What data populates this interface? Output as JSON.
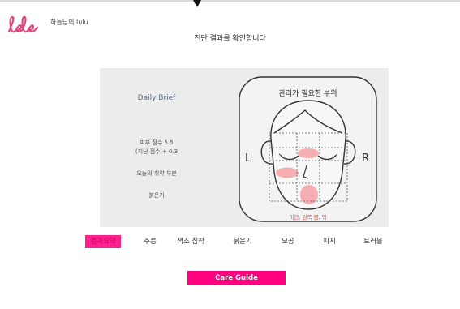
{
  "header": {
    "user_name": "하늘님의 lulu",
    "headline": "진단 결과를 확인합니다"
  },
  "brief": {
    "title": "Daily Brief",
    "skin_score": "피부 점수 5.5",
    "score_change": "(지난 점수 + 0.3",
    "weak_area_label": "오늘의 취약 부분",
    "weak_area_value": "붉은기"
  },
  "face": {
    "title": "관리가 필요한 부위",
    "left_label": "L",
    "right_label": "R",
    "footnote": "미간, 왼쪽 뺨, 턱",
    "highlight_color": "#f4a5a8"
  },
  "tabs": [
    {
      "label": "결과요약",
      "active": true
    },
    {
      "label": "주름"
    },
    {
      "label": "색소 침착"
    },
    {
      "label": "붉은기"
    },
    {
      "label": "모공"
    },
    {
      "label": "피지"
    },
    {
      "label": "트러블"
    }
  ],
  "care_guide": {
    "label": "Care Guide"
  },
  "colors": {
    "accent": "#ff0080",
    "logo": "#e0457b",
    "brief_text": "#5a6a86"
  }
}
